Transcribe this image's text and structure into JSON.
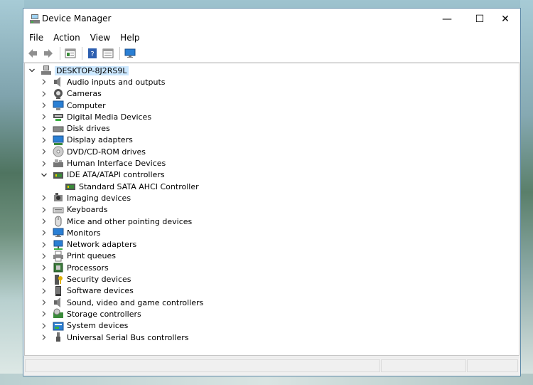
{
  "window": {
    "title": "Device Manager"
  },
  "window_controls": {
    "minimize": "—",
    "maximize": "☐",
    "close": "✕"
  },
  "menubar": {
    "items": [
      "File",
      "Action",
      "View",
      "Help"
    ]
  },
  "toolbar": {
    "buttons": [
      "back-icon",
      "forward-icon",
      "properties-icon",
      "help-icon",
      "view-icon",
      "monitor-icon"
    ]
  },
  "tree": {
    "root": "DESKTOP-8J2RS9L",
    "categories": [
      {
        "label": "Audio inputs and outputs",
        "icon": "speaker-icon",
        "expanded": false
      },
      {
        "label": "Cameras",
        "icon": "camera-icon",
        "expanded": false
      },
      {
        "label": "Computer",
        "icon": "computer-icon",
        "expanded": false
      },
      {
        "label": "Digital Media Devices",
        "icon": "media-device-icon",
        "expanded": false
      },
      {
        "label": "Disk drives",
        "icon": "disk-drive-icon",
        "expanded": false
      },
      {
        "label": "Display adapters",
        "icon": "display-adapter-icon",
        "expanded": false
      },
      {
        "label": "DVD/CD-ROM drives",
        "icon": "dvd-icon",
        "expanded": false
      },
      {
        "label": "Human Interface Devices",
        "icon": "hid-icon",
        "expanded": false
      },
      {
        "label": "IDE ATA/ATAPI controllers",
        "icon": "ide-controller-icon",
        "expanded": true,
        "children": [
          {
            "label": "Standard SATA AHCI Controller",
            "icon": "ide-controller-icon"
          }
        ]
      },
      {
        "label": "Imaging devices",
        "icon": "imaging-icon",
        "expanded": false
      },
      {
        "label": "Keyboards",
        "icon": "keyboard-icon",
        "expanded": false
      },
      {
        "label": "Mice and other pointing devices",
        "icon": "mouse-icon",
        "expanded": false
      },
      {
        "label": "Monitors",
        "icon": "monitor-icon",
        "expanded": false
      },
      {
        "label": "Network adapters",
        "icon": "network-icon",
        "expanded": false
      },
      {
        "label": "Print queues",
        "icon": "printer-icon",
        "expanded": false
      },
      {
        "label": "Processors",
        "icon": "processor-icon",
        "expanded": false
      },
      {
        "label": "Security devices",
        "icon": "security-icon",
        "expanded": false
      },
      {
        "label": "Software devices",
        "icon": "software-device-icon",
        "expanded": false
      },
      {
        "label": "Sound, video and game controllers",
        "icon": "sound-icon",
        "expanded": false
      },
      {
        "label": "Storage controllers",
        "icon": "storage-controller-icon",
        "expanded": false
      },
      {
        "label": "System devices",
        "icon": "system-device-icon",
        "expanded": false
      },
      {
        "label": "Universal Serial Bus controllers",
        "icon": "usb-icon",
        "expanded": false
      }
    ]
  },
  "colors": {
    "selection": "#cce8ff",
    "window_border": "#5e8aa8"
  }
}
